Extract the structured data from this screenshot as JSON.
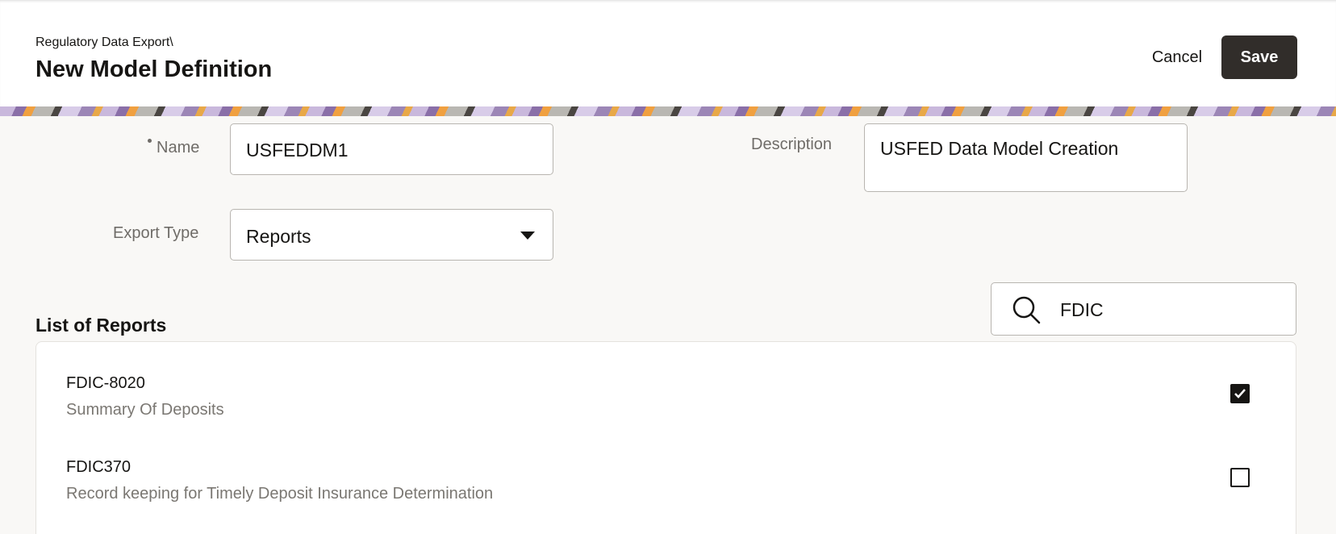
{
  "header": {
    "breadcrumb": "Regulatory Data Export\\",
    "title": "New Model Definition",
    "cancel_label": "Cancel",
    "save_label": "Save"
  },
  "form": {
    "name_label": "Name",
    "name_value": "USFEDDM1",
    "description_label": "Description",
    "description_value": "USFED Data Model Creation",
    "export_type_label": "Export Type",
    "export_type_value": "Reports"
  },
  "search": {
    "value": "FDIC",
    "icon": "search-icon"
  },
  "reports": {
    "title": "List of Reports",
    "items": [
      {
        "code": "FDIC-8020",
        "description": "Summary Of Deposits",
        "checked": true
      },
      {
        "code": "FDIC370",
        "description": "Record keeping for Timely Deposit Insurance Determination",
        "checked": false
      }
    ]
  },
  "colors": {
    "primary_button": "#312d2a",
    "background": "#f9f8f6",
    "label_text": "#6f6c68",
    "secondary_text": "#7a7772"
  }
}
